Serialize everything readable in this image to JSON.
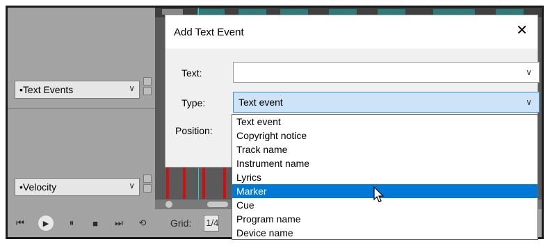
{
  "dialog": {
    "title": "Add Text Event",
    "close_label": "✕",
    "text_label": "Text:",
    "text_value": "",
    "type_label": "Type:",
    "type_value": "Text event",
    "position_label": "Position:"
  },
  "type_options": [
    "Text event",
    "Copyright notice",
    "Track name",
    "Instrument name",
    "Lyrics",
    "Marker",
    "Cue",
    "Program name",
    "Device name"
  ],
  "highlighted_option": "Marker",
  "lanes": {
    "text_events": "•Text Events",
    "velocity": "•Velocity"
  },
  "transport": {
    "grid_label": "Grid:",
    "grid_value": "1/4"
  },
  "icons": {
    "chevron": "⌵",
    "skip_back": "⏮",
    "play": "▶",
    "pause": "⏸",
    "stop": "■",
    "skip_fwd": "⏭",
    "loop": "⟲"
  },
  "colors": {
    "selection": "#0078d7",
    "active_combo": "#cde3f7",
    "note_red": "#d01010",
    "teal": "#2fd0c0"
  }
}
